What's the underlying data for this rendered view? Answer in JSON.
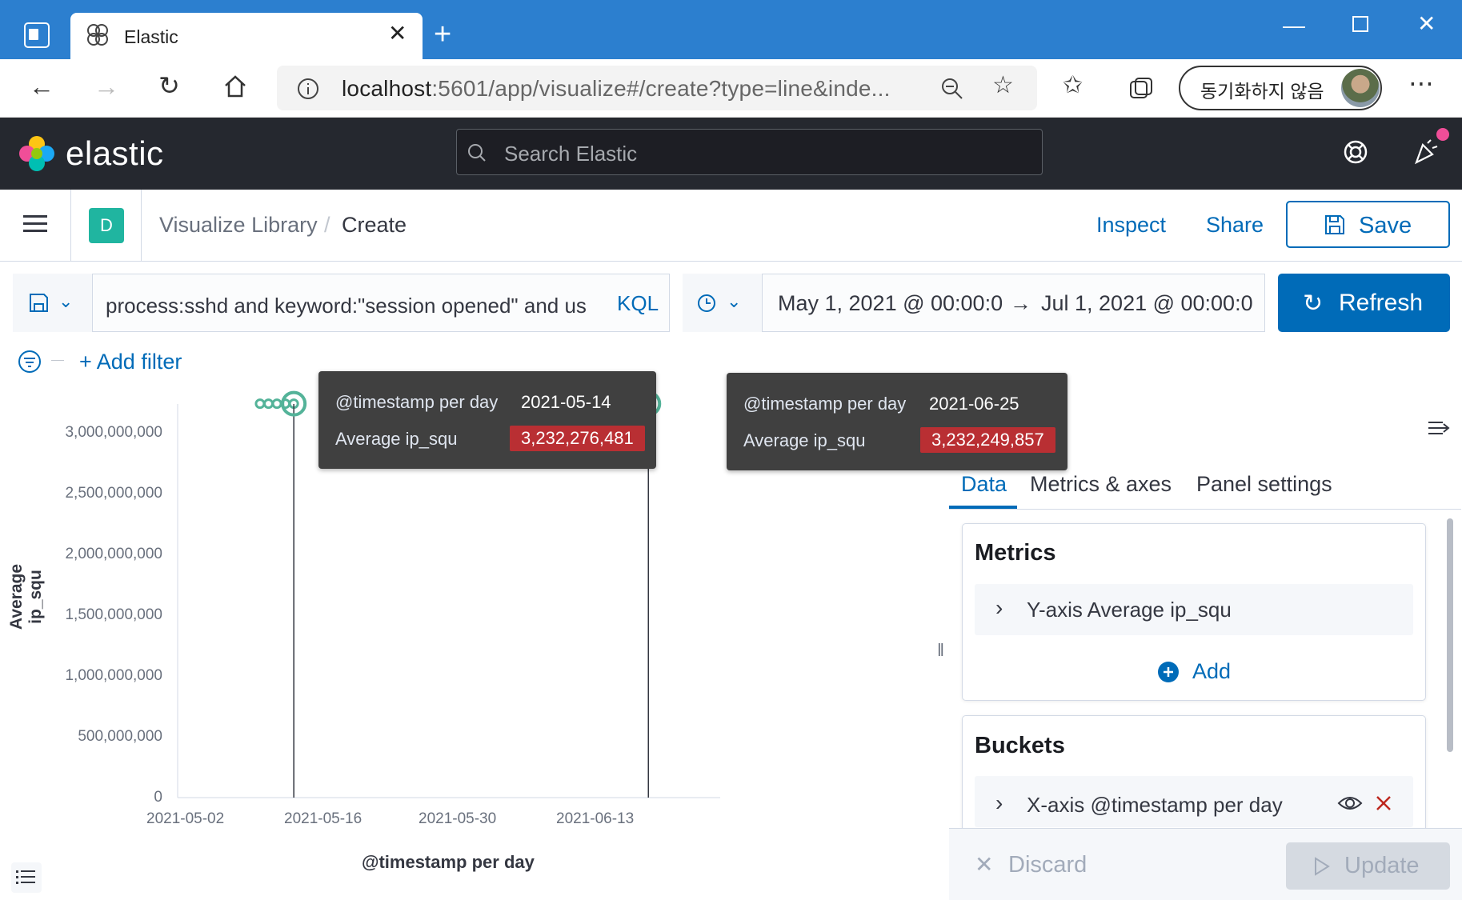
{
  "browser": {
    "tab_title": "Elastic",
    "url_host": "localhost",
    "url_path": ":5601/app/visualize#/create?type=line&inde...",
    "profile_label": "동기화하지 않음"
  },
  "kibana": {
    "logo_text": "elastic",
    "search_placeholder": "Search Elastic",
    "space_initial": "D",
    "breadcrumbs": [
      "Visualize Library",
      "Create"
    ],
    "breadcrumb_separator": "/",
    "actions": {
      "inspect": "Inspect",
      "share": "Share",
      "save": "Save"
    }
  },
  "query": {
    "text": "process:sshd and keyword:\"session opened\" and us",
    "language": "KQL",
    "time_start": "May 1, 2021 @ 00:00:0",
    "time_arrow": "→",
    "time_end": "Jul 1, 2021 @ 00:00:0",
    "refresh": "Refresh",
    "add_filter": "+ Add filter"
  },
  "chart_data": {
    "type": "line",
    "xlabel": "@timestamp per day",
    "ylabel": "Average ip_squ",
    "y_ticks": [
      "3,000,000,000",
      "2,500,000,000",
      "2,000,000,000",
      "1,500,000,000",
      "1,000,000,000",
      "500,000,000",
      "0"
    ],
    "x_ticks": [
      "2021-05-02",
      "2021-05-16",
      "2021-05-30",
      "2021-06-13"
    ],
    "ylim": [
      0,
      3000000000
    ],
    "series": [
      {
        "name": "Average ip_squ",
        "points": [
          {
            "x": "2021-05-10",
            "y": 3232270000
          },
          {
            "x": "2021-05-11",
            "y": 3232270000
          },
          {
            "x": "2021-05-12",
            "y": 3232270000
          },
          {
            "x": "2021-05-13",
            "y": 3232270000
          },
          {
            "x": "2021-05-14",
            "y": 3232276481
          },
          {
            "x": "2021-06-22",
            "y": 3232250000
          },
          {
            "x": "2021-06-23",
            "y": 3232250000
          },
          {
            "x": "2021-06-24",
            "y": 3232250000
          },
          {
            "x": "2021-06-25",
            "y": 3232249857
          }
        ]
      }
    ],
    "grid": false,
    "tooltips": [
      {
        "key1": "@timestamp per day",
        "val1": "2021-05-14",
        "key2": "Average ip_squ",
        "val2": "3,232,276,481"
      },
      {
        "key1": "@timestamp per day",
        "val1": "2021-06-25",
        "key2": "Average ip_squ",
        "val2": "3,232,249,857"
      }
    ]
  },
  "editor": {
    "tabs": [
      "Data",
      "Metrics & axes",
      "Panel settings"
    ],
    "metrics_title": "Metrics",
    "metric_row": "Y-axis Average ip_squ",
    "add_label": "Add",
    "buckets_title": "Buckets",
    "bucket_row": "X-axis @timestamp per day",
    "discard": "Discard",
    "update": "Update"
  },
  "colors": {
    "browser_blue": "#2c7fcf",
    "kibana_dark": "#25282f",
    "primary": "#006bb8",
    "series": "#54b399",
    "tooltip_value_bg": "#b92f33",
    "remove_red": "#bd271e"
  }
}
